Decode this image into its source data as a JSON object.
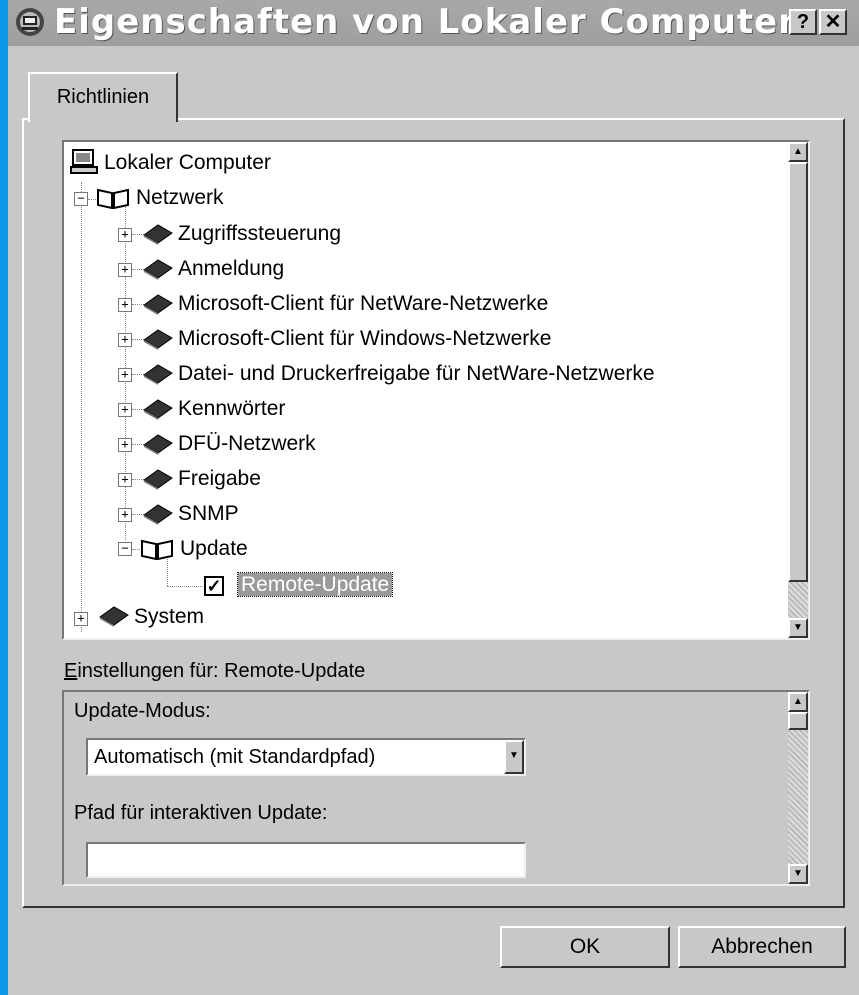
{
  "window": {
    "title": "Eigenschaften von Lokaler Computer",
    "help_label": "?",
    "close_label": "✕"
  },
  "tabs": [
    {
      "label": "Richtlinien"
    }
  ],
  "tree": {
    "root": "Lokaler Computer",
    "netzwerk": "Netzwerk",
    "children": [
      {
        "label": "Zugriffssteuerung"
      },
      {
        "label": "Anmeldung"
      },
      {
        "label": "Microsoft-Client für NetWare-Netzwerke"
      },
      {
        "label": "Microsoft-Client für Windows-Netzwerke"
      },
      {
        "label": "Datei- und Druckerfreigabe für NetWare-Netzwerke"
      },
      {
        "label": "Kennwörter"
      },
      {
        "label": "DFÜ-Netzwerk"
      },
      {
        "label": "Freigabe"
      },
      {
        "label": "SNMP"
      }
    ],
    "update": "Update",
    "remote_update": "Remote-Update",
    "system": "System"
  },
  "settings": {
    "label_prefix": "E",
    "label_rest": "instellungen für: Remote-Update",
    "mode_label": "Update-Modus:",
    "mode_value": "Automatisch (mit Standardpfad)",
    "path_label": "Pfad für interaktiven Update:",
    "path_value": ""
  },
  "buttons": {
    "ok": "OK",
    "cancel": "Abbrechen"
  }
}
